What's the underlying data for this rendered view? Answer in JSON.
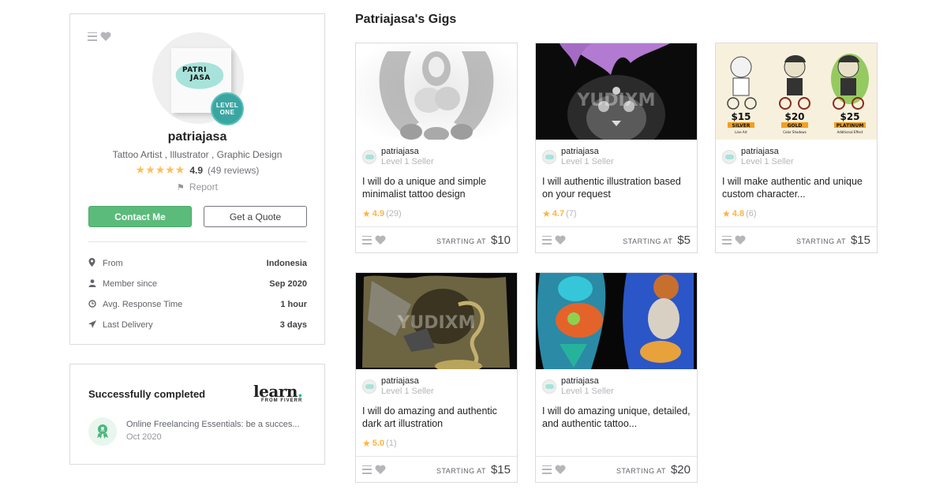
{
  "profile": {
    "avatar_logo_line1": "PATRI",
    "avatar_logo_line2": "JASA",
    "level_badge_line1": "LEVEL",
    "level_badge_line2": "ONE",
    "username": "patriajasa",
    "tagline": "Tattoo Artist , Illustrator , Graphic Design",
    "stars": "★★★★★",
    "rating": "4.9",
    "reviews": "(49 reviews)",
    "report_label": "Report",
    "contact_button": "Contact Me",
    "quote_button": "Get a Quote",
    "stats": [
      {
        "icon": "location-pin-icon",
        "label": "From",
        "value": "Indonesia"
      },
      {
        "icon": "user-icon",
        "label": "Member since",
        "value": "Sep 2020"
      },
      {
        "icon": "clock-icon",
        "label": "Avg. Response Time",
        "value": "1 hour"
      },
      {
        "icon": "paper-plane-icon",
        "label": "Last Delivery",
        "value": "3 days"
      }
    ]
  },
  "learn": {
    "title": "Successfully completed",
    "logo_word": "learn",
    "logo_dot": ".",
    "logo_sub": "FROM FIVERR",
    "course_name": "Online Freelancing Essentials: be a succes...",
    "course_date": "Oct 2020"
  },
  "gigs_section": {
    "title": "Patriajasa's Gigs",
    "starting_at_label": "STARTING AT",
    "gigs": [
      {
        "seller": "patriajasa",
        "level": "Level 1 Seller",
        "title": "I will do a unique and simple minimalist tattoo design",
        "rating": "4.9",
        "count": "(29)",
        "price": "$10"
      },
      {
        "seller": "patriajasa",
        "level": "Level 1 Seller",
        "title": "I will authentic illustration based on your request",
        "rating": "4.7",
        "count": "(7)",
        "price": "$5"
      },
      {
        "seller": "patriajasa",
        "level": "Level 1 Seller",
        "title": "I will make authentic and unique custom character...",
        "rating": "4.8",
        "count": "(6)",
        "price": "$15"
      },
      {
        "seller": "patriajasa",
        "level": "Level 1 Seller",
        "title": "I will do amazing and authentic dark art illustration",
        "rating": "5.0",
        "count": "(1)",
        "price": "$15"
      },
      {
        "seller": "patriajasa",
        "level": "Level 1 Seller",
        "title": "I will do amazing unique, detailed, and authentic tattoo...",
        "rating": null,
        "count": null,
        "price": "$20"
      }
    ],
    "image_watermark": "YUDIXM",
    "character_tiers": [
      {
        "price": "$15",
        "tier": "SILVER",
        "desc": "Line Art"
      },
      {
        "price": "$20",
        "tier": "GOLD",
        "desc": "Color Shadows"
      },
      {
        "price": "$25",
        "tier": "PLATINUM",
        "desc": "Additional Effect"
      }
    ]
  }
}
